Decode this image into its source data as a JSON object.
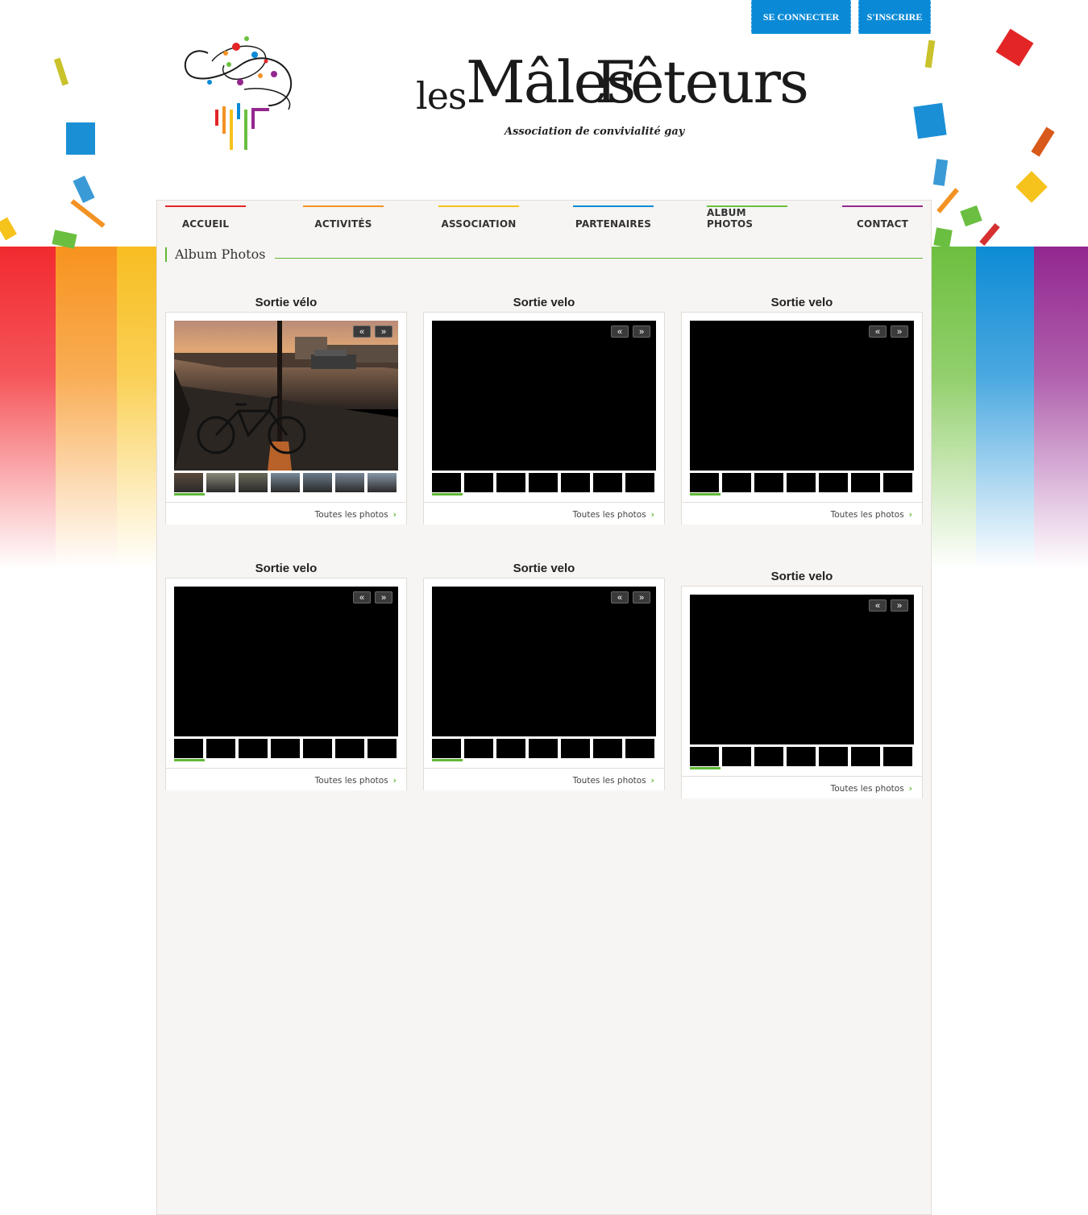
{
  "header": {
    "login_label": "SE CONNECTER",
    "signup_label": "S'INSCRIRE",
    "logo_word_les": "les",
    "logo_word_males": "Mâles",
    "logo_word_feteurs": "Fêteurs",
    "tagline": "Association de convivialité gay"
  },
  "nav": {
    "items": [
      {
        "label": "ACCUEIL",
        "color": "#e32526"
      },
      {
        "label": "ACTIVITÉS",
        "color": "#f39224"
      },
      {
        "label": "ASSOCIATION",
        "color": "#f6c21c"
      },
      {
        "label": "PARTENAIRES",
        "color": "#0a8ad6"
      },
      {
        "label": "ALBUM PHOTOS",
        "color": "#6abf40"
      },
      {
        "label": "CONTACT",
        "color": "#93278f"
      }
    ]
  },
  "section": {
    "title": "Album Photos"
  },
  "albums": [
    {
      "title": "Sortie vélo",
      "link": "Toutes les photos"
    },
    {
      "title": "Sortie velo",
      "link": "Toutes les photos"
    },
    {
      "title": "Sortie velo",
      "link": "Toutes les photos"
    },
    {
      "title": "Sortie velo",
      "link": "Toutes les photos"
    },
    {
      "title": "Sortie velo",
      "link": "Toutes les photos"
    },
    {
      "title": "Sortie velo",
      "link": "Toutes les photos"
    }
  ],
  "controls": {
    "prev": "«",
    "next": "»"
  },
  "colors": {
    "accent_green": "#5fb836",
    "button_blue": "#0a8ad6",
    "stripe_left": [
      "#f12a2f",
      "#f7931e",
      "#f8bd22"
    ],
    "stripe_right": [
      "#6dbf3f",
      "#0d8bd5",
      "#92278f"
    ]
  }
}
